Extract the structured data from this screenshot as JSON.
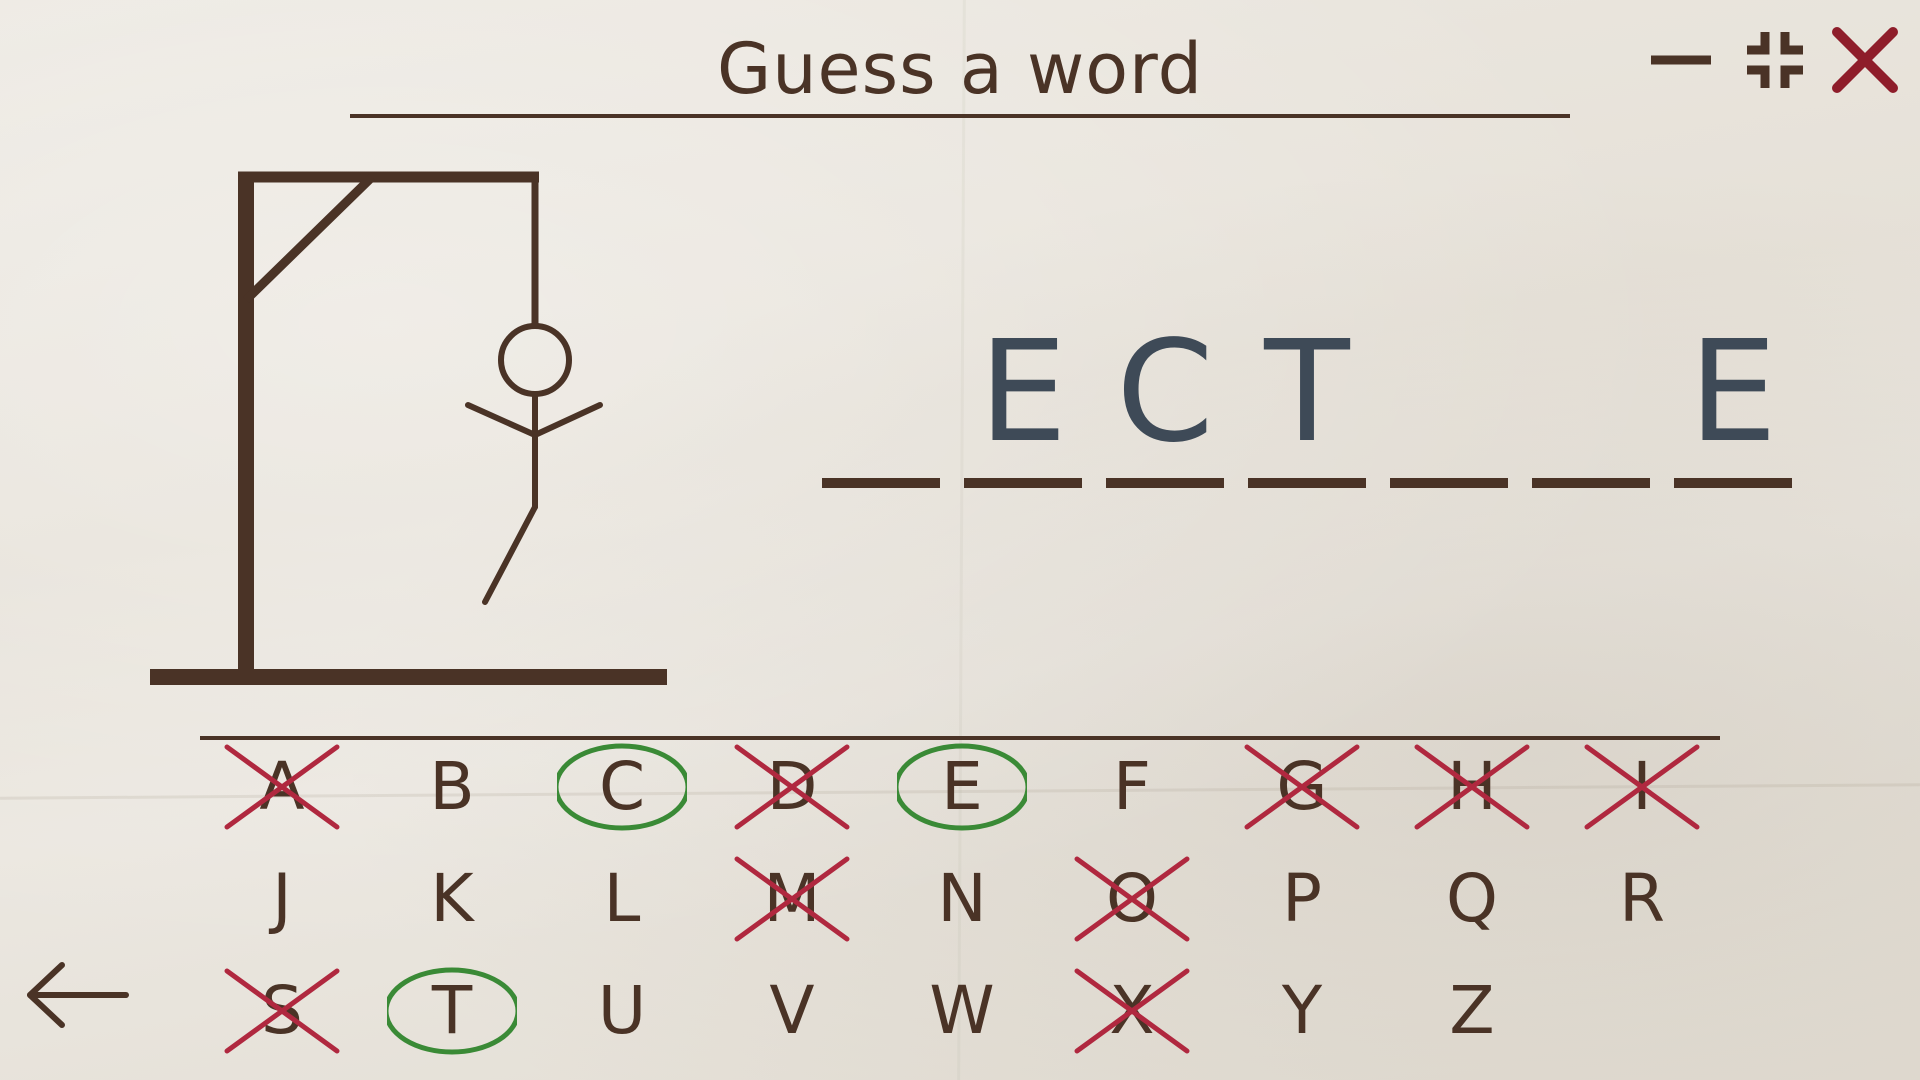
{
  "header": {
    "title": "Guess a word"
  },
  "window_controls": [
    {
      "name": "minimize-icon",
      "color": "#4a3326"
    },
    {
      "name": "exit-fullscreen-icon",
      "color": "#4a3326"
    },
    {
      "name": "close-icon",
      "color": "#8e1d2a"
    }
  ],
  "colors": {
    "ink": "#4a3326",
    "word_letter": "#3e4a57",
    "correct_circle": "#3a8a36",
    "wrong_cross": "#b0283f",
    "close_button": "#8e1d2a"
  },
  "hangman": {
    "parts_shown": [
      "head",
      "body",
      "left-arm",
      "right-arm",
      "left-leg"
    ]
  },
  "word": {
    "slots": [
      "",
      "E",
      "C",
      "T",
      "",
      "",
      "E"
    ]
  },
  "keyboard": {
    "rows": [
      [
        {
          "letter": "A",
          "state": "wrong"
        },
        {
          "letter": "B",
          "state": "unused"
        },
        {
          "letter": "C",
          "state": "correct"
        },
        {
          "letter": "D",
          "state": "wrong"
        },
        {
          "letter": "E",
          "state": "correct"
        },
        {
          "letter": "F",
          "state": "unused"
        },
        {
          "letter": "G",
          "state": "wrong"
        },
        {
          "letter": "H",
          "state": "wrong"
        },
        {
          "letter": "I",
          "state": "wrong"
        }
      ],
      [
        {
          "letter": "J",
          "state": "unused"
        },
        {
          "letter": "K",
          "state": "unused"
        },
        {
          "letter": "L",
          "state": "unused"
        },
        {
          "letter": "M",
          "state": "wrong"
        },
        {
          "letter": "N",
          "state": "unused"
        },
        {
          "letter": "O",
          "state": "wrong"
        },
        {
          "letter": "P",
          "state": "unused"
        },
        {
          "letter": "Q",
          "state": "unused"
        },
        {
          "letter": "R",
          "state": "unused"
        }
      ],
      [
        {
          "letter": "S",
          "state": "wrong"
        },
        {
          "letter": "T",
          "state": "correct"
        },
        {
          "letter": "U",
          "state": "unused"
        },
        {
          "letter": "V",
          "state": "unused"
        },
        {
          "letter": "W",
          "state": "unused"
        },
        {
          "letter": "X",
          "state": "wrong"
        },
        {
          "letter": "Y",
          "state": "unused"
        },
        {
          "letter": "Z",
          "state": "unused"
        }
      ]
    ]
  },
  "navigation": {
    "back_icon": "arrow-left-icon"
  }
}
